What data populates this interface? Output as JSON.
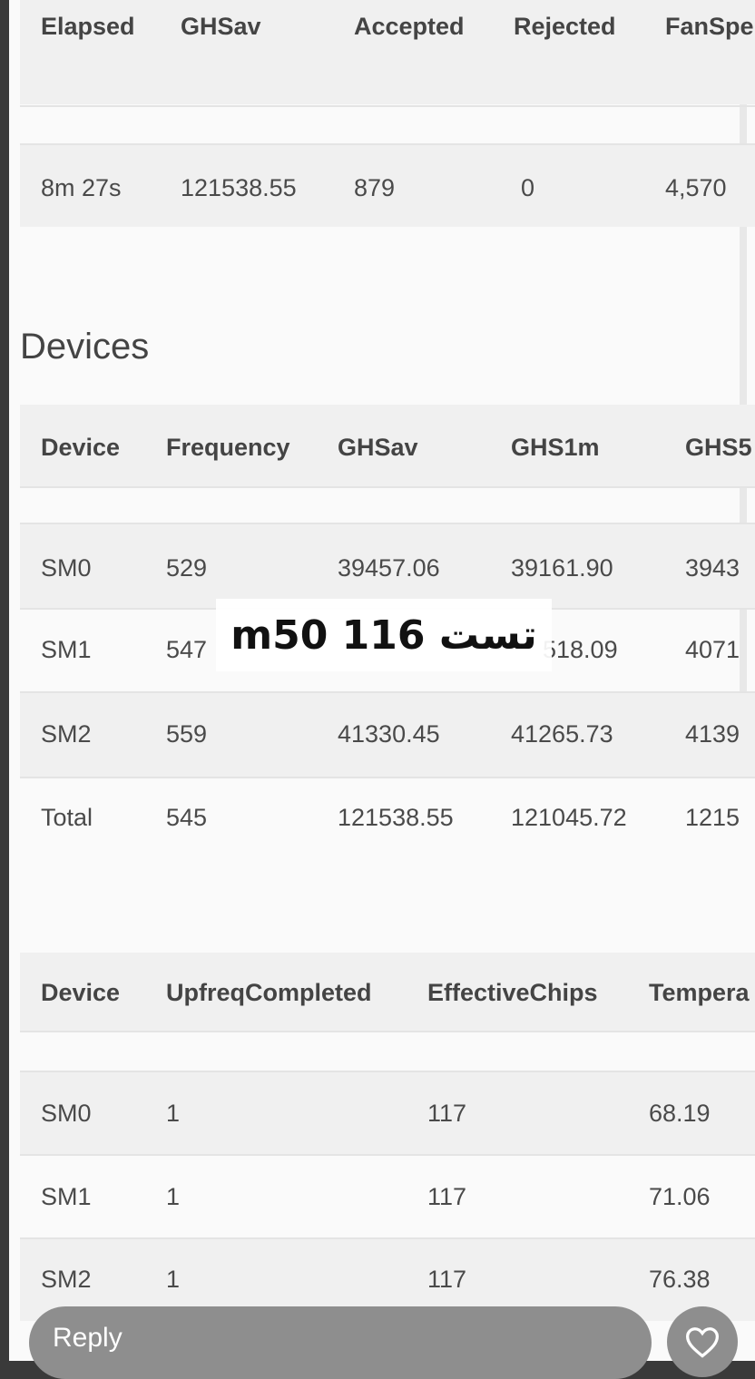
{
  "summary_table": {
    "headers": [
      "Elapsed",
      "GHSav",
      "Accepted",
      "Rejected",
      "FanSpe"
    ],
    "row": [
      "8m 27s",
      "121538.55",
      "879",
      "0",
      "4,570"
    ]
  },
  "devices_section": {
    "title": "Devices",
    "table1": {
      "headers": [
        "Device",
        "Frequency",
        "GHSav",
        "GHS1m",
        "GHS5"
      ],
      "rows": [
        [
          "SM0",
          "529",
          "39457.06",
          "39161.90",
          "3943"
        ],
        [
          "SM1",
          "547",
          "",
          "518.09",
          "4071"
        ],
        [
          "SM2",
          "559",
          "41330.45",
          "41265.73",
          "4139"
        ],
        [
          "Total",
          "545",
          "121538.55",
          "121045.72",
          "1215"
        ]
      ]
    },
    "table2": {
      "headers": [
        "Device",
        "UpfreqCompleted",
        "EffectiveChips",
        "Tempera"
      ],
      "rows": [
        [
          "SM0",
          "1",
          "117",
          "68.19"
        ],
        [
          "SM1",
          "1",
          "117",
          "71.06"
        ],
        [
          "SM2",
          "1",
          "117",
          "76.38"
        ]
      ]
    }
  },
  "overlay_caption": "m50 116 تست",
  "reply": {
    "label": "Reply",
    "heart_icon": "heart-outline-icon"
  }
}
